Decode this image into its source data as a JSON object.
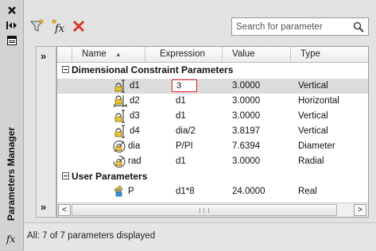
{
  "window": {
    "title": "Parameters Manager",
    "icons": [
      "close-icon",
      "auto-hide-icon",
      "properties-icon",
      "fx-icon"
    ],
    "fx_symbol": "fx"
  },
  "toolbar": {
    "icons": [
      "filter-icon",
      "new-user-parameter-icon",
      "delete-parameter-icon"
    ],
    "fx_symbol": "fx",
    "delete_color": "#d23a2a"
  },
  "search": {
    "placeholder": "Search for parameter",
    "icon": "search-icon"
  },
  "side": {
    "expand_top": "»",
    "expand_bottom": "»"
  },
  "table": {
    "columns": [
      "Name",
      "Expression",
      "Value",
      "Type"
    ],
    "sort_indicator": "▲",
    "groups": [
      {
        "label": "Dimensional Constraint Parameters",
        "rows": [
          {
            "name": "d1",
            "expression": "3",
            "value": "3.0000",
            "type": "Vertical",
            "icon": "vertical-dimension-icon"
          },
          {
            "name": "d2",
            "expression": "d1",
            "value": "3.0000",
            "type": "Horizontal",
            "icon": "horizontal-dimension-icon"
          },
          {
            "name": "d3",
            "expression": "d1",
            "value": "3.0000",
            "type": "Vertical",
            "icon": "vertical-dimension-icon"
          },
          {
            "name": "d4",
            "expression": "dia/2",
            "value": "3.8197",
            "type": "Vertical",
            "icon": "vertical-dimension-icon"
          },
          {
            "name": "dia",
            "expression": "P/PI",
            "value": "7.6394",
            "type": "Diameter",
            "icon": "diameter-dimension-icon"
          },
          {
            "name": "rad",
            "expression": "d1",
            "value": "3.0000",
            "type": "Radial",
            "icon": "radial-dimension-icon"
          }
        ]
      },
      {
        "label": "User Parameters",
        "rows": [
          {
            "name": "P",
            "expression": "d1*8",
            "value": "24.0000",
            "type": "Real",
            "icon": "user-parameter-icon"
          }
        ]
      }
    ]
  },
  "scrollbar": {
    "left_arrow": "<",
    "right_arrow": ">"
  },
  "status": {
    "text": "All: 7 of 7 parameters displayed"
  },
  "colors": {
    "selected_row": "#dcdcdc",
    "edit_border": "#d22222",
    "lock_yellow": "#e8c23a"
  }
}
